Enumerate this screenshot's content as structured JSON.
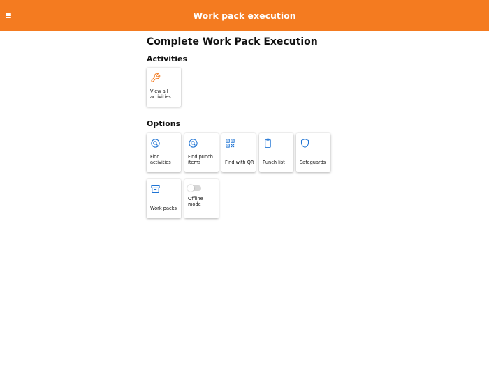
{
  "header": {
    "title": "Work pack execution",
    "menu_icon": "hamburger-menu-icon",
    "background_color": "#f47b20"
  },
  "page": {
    "title": "Complete Work Pack Execution"
  },
  "activities": {
    "title": "Activities",
    "tiles": [
      {
        "label": "View all activities",
        "icon": "wrench-icon"
      }
    ]
  },
  "options": {
    "title": "Options",
    "tiles": [
      {
        "label": "Find activities",
        "icon": "search-icon"
      },
      {
        "label": "Find punch items",
        "icon": "search-icon"
      },
      {
        "label": "Find with QR",
        "icon": "qr-code-icon"
      },
      {
        "label": "Punch list",
        "icon": "clipboard-icon"
      },
      {
        "label": "Safeguards",
        "icon": "shield-icon"
      },
      {
        "label": "Work packs",
        "icon": "archive-box-icon"
      },
      {
        "label": "Offline mode",
        "icon": "toggle-switch",
        "toggle_on": false
      }
    ]
  },
  "colors": {
    "accent": "#f47b20",
    "icon_blue": "#1f74d4",
    "icon_orange": "#f47b20"
  }
}
